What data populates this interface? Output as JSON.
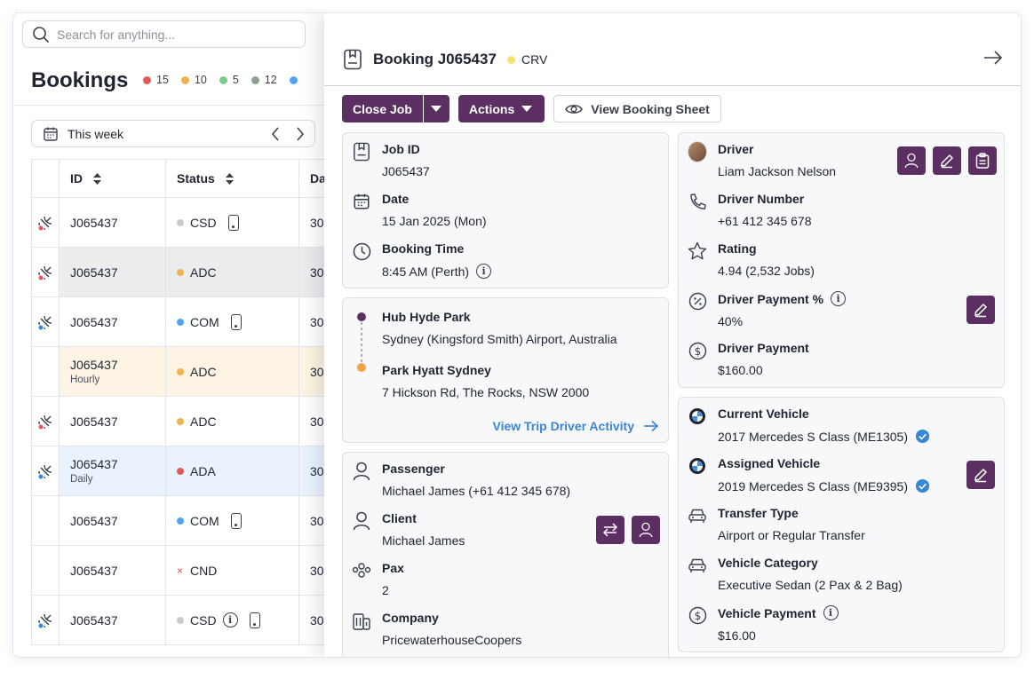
{
  "search": {
    "placeholder": "Search for anything..."
  },
  "bookings": {
    "title": "Bookings",
    "counts": [
      {
        "value": "15",
        "color": "#e45757"
      },
      {
        "value": "10",
        "color": "#f4b04b"
      },
      {
        "value": "5",
        "color": "#78cf8d"
      },
      {
        "value": "12",
        "color": "#8aa38f"
      }
    ],
    "extra_dot_color": "#4fa3f5",
    "week_label": "This week",
    "columns": {
      "id": "ID",
      "status": "Status",
      "date": "Da"
    },
    "rows": [
      {
        "id": "J065437",
        "sub": "",
        "status": "CSD",
        "status_color": "#c9cbd0",
        "phone": true,
        "info": false,
        "date": "30",
        "icon": "red",
        "style": ""
      },
      {
        "id": "J065437",
        "sub": "",
        "status": "ADC",
        "status_color": "#f4b04b",
        "phone": false,
        "info": false,
        "date": "30",
        "icon": "red",
        "style": "gray"
      },
      {
        "id": "J065437",
        "sub": "",
        "status": "COM",
        "status_color": "#4fa3f5",
        "phone": true,
        "info": false,
        "date": "30",
        "icon": "blue",
        "style": ""
      },
      {
        "id": "J065437",
        "sub": "Hourly",
        "status": "ADC",
        "status_color": "#f4b04b",
        "phone": false,
        "info": false,
        "date": "30",
        "icon": "none",
        "style": "yellow"
      },
      {
        "id": "J065437",
        "sub": "",
        "status": "ADC",
        "status_color": "#f4b04b",
        "phone": false,
        "info": false,
        "date": "30",
        "icon": "red",
        "style": ""
      },
      {
        "id": "J065437",
        "sub": "Daily",
        "status": "ADA",
        "status_color": "#e45757",
        "phone": false,
        "info": false,
        "date": "30",
        "icon": "blue",
        "style": "blue"
      },
      {
        "id": "J065437",
        "sub": "",
        "status": "COM",
        "status_color": "#4fa3f5",
        "phone": true,
        "info": false,
        "date": "30",
        "icon": "none",
        "style": ""
      },
      {
        "id": "J065437",
        "sub": "",
        "status": "CND",
        "status_color": "x",
        "phone": false,
        "info": false,
        "date": "30",
        "icon": "none",
        "style": ""
      },
      {
        "id": "J065437",
        "sub": "",
        "status": "CSD",
        "status_color": "#c9cbd0",
        "phone": true,
        "info": true,
        "date": "30",
        "icon": "blue",
        "style": ""
      }
    ]
  },
  "panel": {
    "title": "Booking J065437",
    "badge": "CRV",
    "badge_color": "#f7e36b",
    "close_job": "Close Job",
    "actions": "Actions",
    "view_sheet": "View Booking Sheet",
    "job": {
      "job_id_label": "Job ID",
      "job_id": "J065437",
      "date_label": "Date",
      "date": "15 Jan 2025 (Mon)",
      "time_label": "Booking Time",
      "time": "8:45 AM (Perth)"
    },
    "trip": {
      "from_name": "Hub Hyde Park",
      "from_addr": "Sydney (Kingsford Smith) Airport, Australia",
      "to_name": "Park Hyatt Sydney",
      "to_addr": "7 Hickson Rd, The Rocks, NSW 2000",
      "link": "View Trip Driver Activity"
    },
    "people": {
      "passenger_label": "Passenger",
      "passenger": "Michael James (+61 412 345 678)",
      "client_label": "Client",
      "client": "Michael James",
      "pax_label": "Pax",
      "pax": "2",
      "company_label": "Company",
      "company": "PricewaterhouseCoopers"
    },
    "driver": {
      "driver_label": "Driver",
      "driver": "Liam Jackson Nelson",
      "number_label": "Driver Number",
      "number": "+61 412 345 678",
      "rating_label": "Rating",
      "rating": "4.94 (2,532 Jobs)",
      "pay_pct_label": "Driver Payment %",
      "pay_pct": "40%",
      "payment_label": "Driver Payment",
      "payment": "$160.00"
    },
    "vehicle": {
      "current_label": "Current Vehicle",
      "current": "2017 Mercedes S Class (ME1305)",
      "assigned_label": "Assigned Vehicle",
      "assigned": "2019 Mercedes S Class (ME9395)",
      "transfer_label": "Transfer Type",
      "transfer": "Airport or Regular Transfer",
      "category_label": "Vehicle Category",
      "category": "Executive Sedan (2 Pax & 2 Bag)",
      "payment_label": "Vehicle Payment",
      "payment": "$16.00"
    }
  }
}
